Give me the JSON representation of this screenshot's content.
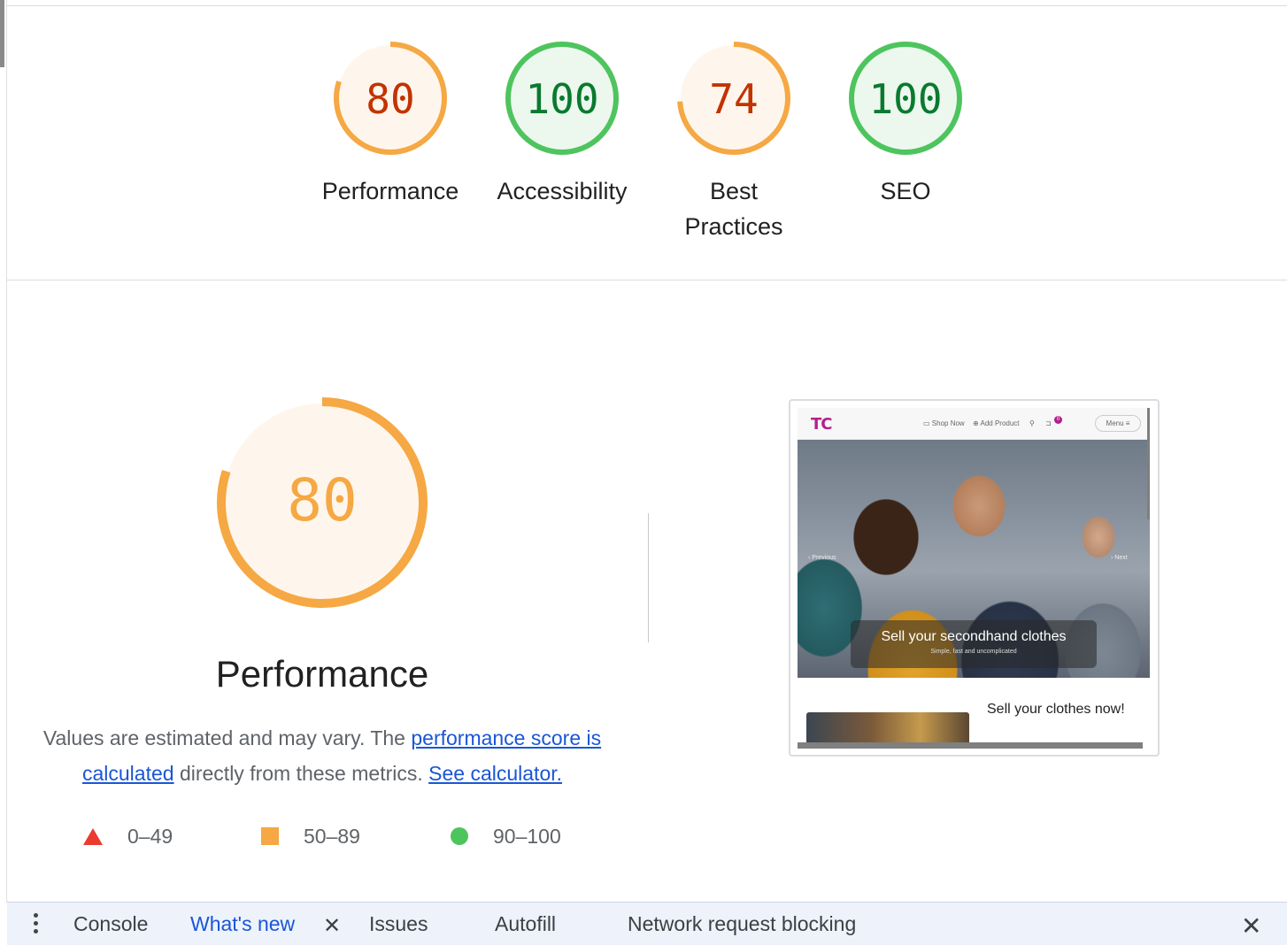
{
  "categories": [
    {
      "score": "80",
      "label": "Performance",
      "fraction": 0.8,
      "color": "#f5a843",
      "text_color": "#c33300",
      "bg": "#fef6ec"
    },
    {
      "score": "100",
      "label": "Accessibility",
      "fraction": 1.0,
      "color": "#4ec45e",
      "text_color": "#0a7a2f",
      "bg": "#ecf8ee"
    },
    {
      "score": "74",
      "label_line1": "Best",
      "label_line2": "Practices",
      "fraction": 0.74,
      "color": "#f5a843",
      "text_color": "#c33300",
      "bg": "#fef6ec"
    },
    {
      "score": "100",
      "label": "SEO",
      "fraction": 1.0,
      "color": "#4ec45e",
      "text_color": "#0a7a2f",
      "bg": "#ecf8ee"
    }
  ],
  "performance": {
    "score": "80",
    "fraction": 0.8,
    "title": "Performance",
    "desc_pre": "Values are estimated and may vary. The ",
    "link1": "performance score is calculated",
    "desc_mid": " directly from these metrics. ",
    "link2": "See calculator.",
    "color": "#f5a843",
    "text_color": "#f5a843"
  },
  "legend": {
    "fail": "0–49",
    "average": "50–89",
    "pass": "90–100"
  },
  "screenshot": {
    "logo": "TC",
    "nav_shop": "▭ Shop Now",
    "nav_add": "⊕ Add Product",
    "nav_search": "⚲",
    "cart_badge": "0",
    "menu": "Menu ≡",
    "prev": "‹ Previous",
    "next": "› Next",
    "hero_title": "Sell your secondhand clothes",
    "hero_sub": "Simple, fast and uncomplicated",
    "promo": "Sell your clothes now!"
  },
  "drawer": {
    "tabs": [
      "Console",
      "What's new",
      "Issues",
      "Autofill",
      "Network request blocking"
    ],
    "active_tab": "What's new",
    "kebab_icon": "more-vert-icon",
    "close_icon": "close-icon"
  }
}
